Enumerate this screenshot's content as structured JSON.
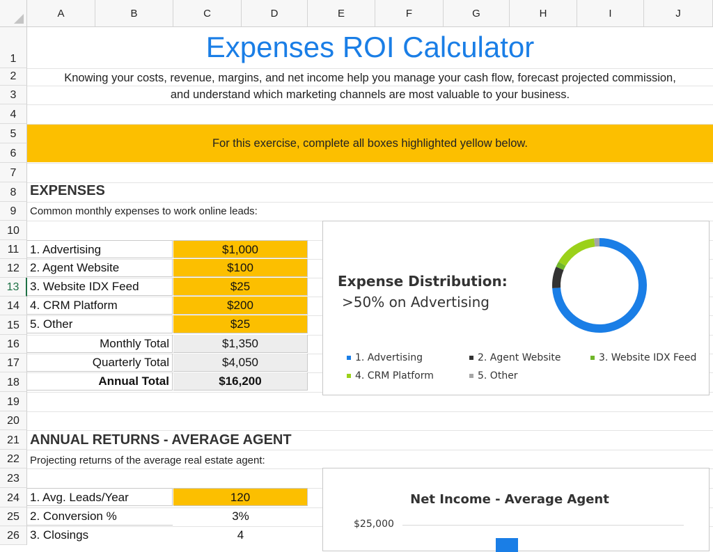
{
  "columns": [
    "A",
    "B",
    "C",
    "D",
    "E",
    "F",
    "G",
    "H",
    "I",
    "J"
  ],
  "rows": [
    "1",
    "2",
    "3",
    "4",
    "5",
    "6",
    "7",
    "8",
    "9",
    "10",
    "11",
    "12",
    "13",
    "14",
    "15",
    "16",
    "17",
    "18",
    "19",
    "20",
    "21",
    "22",
    "23",
    "24",
    "25",
    "26"
  ],
  "active_row": "13",
  "title": "Expenses ROI Calculator",
  "description": {
    "line1": "Knowing your costs, revenue, margins, and net income help you manage your cash flow, forecast projected commission,",
    "line2": "and understand which marketing channels are most valuable to your business."
  },
  "banner": "For this exercise, complete all boxes highlighted yellow below.",
  "expenses": {
    "heading": "EXPENSES",
    "subtitle": "Common monthly expenses to work online leads:",
    "items": [
      {
        "label": "1. Advertising",
        "value": "$1,000"
      },
      {
        "label": "2. Agent Website",
        "value": "$100"
      },
      {
        "label": "3. Website IDX Feed",
        "value": "$25"
      },
      {
        "label": "4. CRM Platform",
        "value": "$200"
      },
      {
        "label": "5. Other",
        "value": "$25"
      }
    ],
    "totals": [
      {
        "label": "Monthly Total",
        "value": "$1,350"
      },
      {
        "label": "Quarterly Total",
        "value": "$4,050"
      },
      {
        "label": "Annual Total",
        "value": "$16,200"
      }
    ]
  },
  "returns": {
    "heading": "ANNUAL RETURNS - AVERAGE AGENT",
    "subtitle": "Projecting returns of the average real estate agent:",
    "items": [
      {
        "label": "1. Avg. Leads/Year",
        "value": "120"
      },
      {
        "label": "2. Conversion %",
        "value": "3%"
      },
      {
        "label": "3. Closings",
        "value": "4"
      }
    ]
  },
  "colors": {
    "accent_yellow": "#fcbf00",
    "title_blue": "#1a7ee6",
    "advertising": "#1a7ee6",
    "agent_website": "#333333",
    "idx_feed": "#70b62a",
    "crm": "#9bd11a",
    "other": "#a6a6a6"
  },
  "chart_data": [
    {
      "type": "pie",
      "title": "Expense Distribution:",
      "subtitle": ">50% on Advertising",
      "categories": [
        "1. Advertising",
        "2. Agent Website",
        "3. Website IDX Feed",
        "4. CRM Platform",
        "5. Other"
      ],
      "values": [
        1000,
        100,
        25,
        200,
        25
      ],
      "legend": "bottom"
    },
    {
      "type": "bar",
      "title": "Net Income - Average Agent",
      "y_tick_labels": [
        "$25,000"
      ],
      "ylim": [
        0,
        25000
      ],
      "grid": true
    }
  ]
}
